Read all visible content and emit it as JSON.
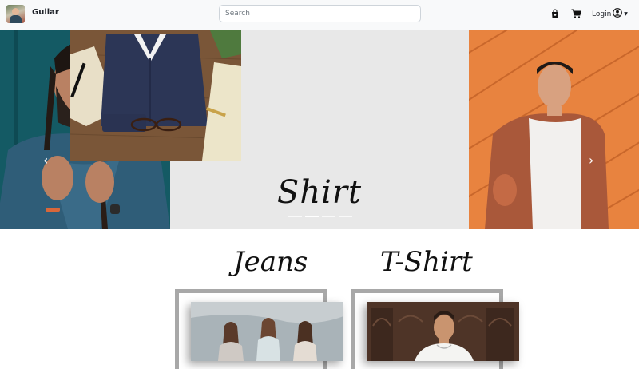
{
  "navbar": {
    "brand_name": "Gullar",
    "search_placeholder": "Search",
    "login_label": "Login",
    "icons": [
      "shopping-bag-icon",
      "cart-icon",
      "user-circle-icon",
      "caret-down-icon"
    ]
  },
  "carousel": {
    "caption": "Shirt",
    "slide_count": 4,
    "active_index": 1,
    "prev_glyph": "‹",
    "next_glyph": "›"
  },
  "categories": [
    {
      "title": "Jeans"
    },
    {
      "title": "T-Shirt"
    }
  ],
  "colors": {
    "navbar_bg": "#f8f9fa",
    "carousel_bg": "#e8e8e8",
    "frame": "#a8a8a8",
    "left_slide": "#18606b",
    "right_slide": "#e6823f"
  }
}
